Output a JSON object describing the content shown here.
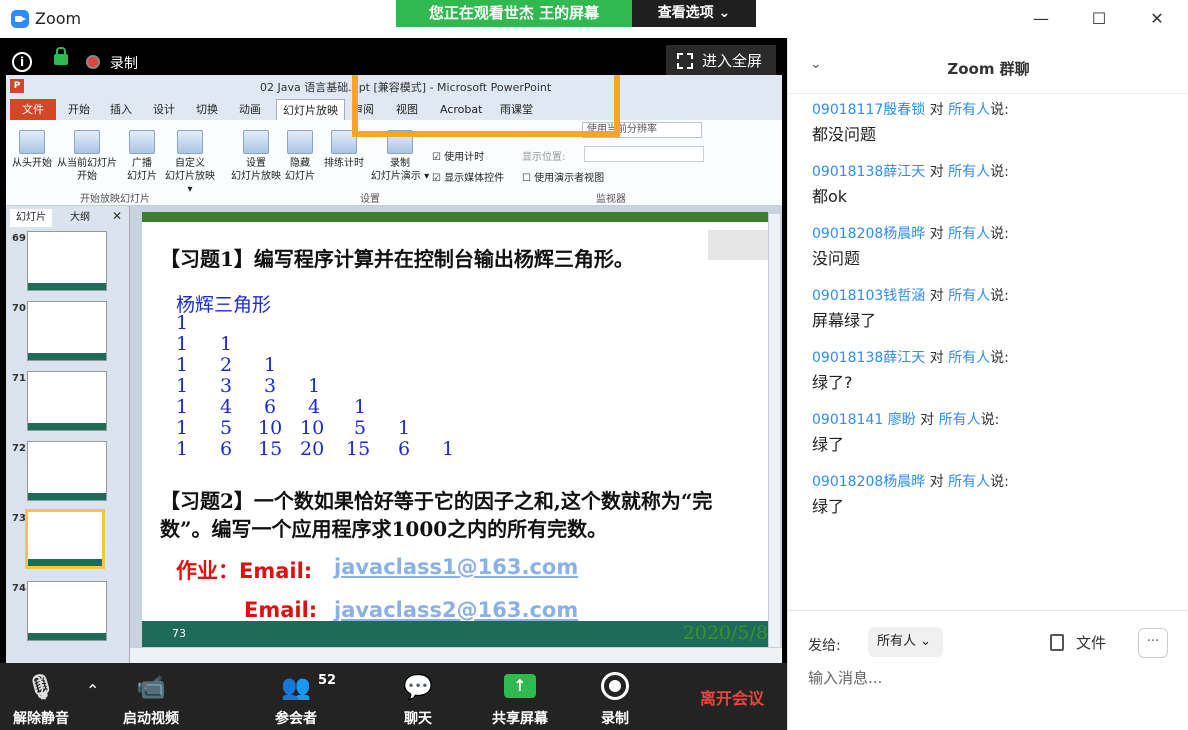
{
  "window": {
    "title": "Zoom",
    "minimize": "—",
    "maximize": "☐",
    "close": "✕"
  },
  "share_banner": {
    "text": "您正在观看世杰 王的屏幕",
    "view_options": "查看选项 ⌄"
  },
  "meeting_top": {
    "info": "i",
    "record_label": "录制",
    "fullscreen": "进入全屏"
  },
  "ppt": {
    "window_title": "02 Java 语言基础.ppt [兼容模式] - Microsoft PowerPoint",
    "tabs": [
      "文件",
      "开始",
      "插入",
      "设计",
      "切换",
      "动画",
      "幻灯片放映",
      "审阅",
      "视图",
      "Acrobat",
      "雨课堂"
    ],
    "ribbon_buttons": [
      {
        "label": "从头开始"
      },
      {
        "label": "从当前幻灯片\n开始"
      },
      {
        "label": "广播\n幻灯片"
      },
      {
        "label": "自定义\n幻灯片放映 ▾"
      },
      {
        "label": "设置\n幻灯片放映"
      },
      {
        "label": "隐藏\n幻灯片"
      },
      {
        "label": "排练计时"
      },
      {
        "label": "录制\n幻灯片演示 ▾"
      }
    ],
    "checkboxes": [
      "使用计时",
      "显示媒体控件",
      "使用演示者视图"
    ],
    "monitor": {
      "resolution": "使用当前分辨率",
      "display_label": "显示位置:"
    },
    "groups": [
      "开始放映幻灯片",
      "设置",
      "监视器"
    ],
    "pane_tabs": [
      "幻灯片",
      "大纲"
    ],
    "thumb_numbers": [
      "69",
      "70",
      "71",
      "72",
      "73",
      "74"
    ],
    "slide": {
      "exercise1": "【习题1】编写程序计算并在控制台输出杨辉三角形。",
      "yh_title": "杨辉三角形",
      "yh_rows": [
        [
          "1"
        ],
        [
          "1",
          "1"
        ],
        [
          "1",
          "2",
          "1"
        ],
        [
          "1",
          "3",
          "3",
          "1"
        ],
        [
          "1",
          "4",
          "6",
          "4",
          "1"
        ],
        [
          "1",
          "5",
          "10",
          "10",
          "5",
          "1"
        ],
        [
          "1",
          "6",
          "15",
          "20",
          "15",
          "6",
          "1"
        ]
      ],
      "exercise2": "【习题2】一个数如果恰好等于它的因子之和,这个数就称为“完数”。编写一个应用程序求1000之内的所有完数。",
      "homework_label": "作业：Email:",
      "email_label": "Email:",
      "email1": "javaclass1@163.com",
      "email2": "javaclass2@163.com",
      "page_number": "73",
      "date": "2020/5/8"
    }
  },
  "toolbar": {
    "unmute": "解除静音",
    "start_video": "启动视频",
    "participants": "参会者",
    "participant_count": "52",
    "chat": "聊天",
    "share": "共享屏幕",
    "record": "录制",
    "leave": "离开会议"
  },
  "chat": {
    "title": "Zoom 群聊",
    "messages": [
      {
        "sender": "09018117殷春锁",
        "to": "所有人",
        "text": "都没问题"
      },
      {
        "sender": "09018138薛江天",
        "to": "所有人",
        "text": "都ok"
      },
      {
        "sender": "09018208杨晨晔",
        "to": "所有人",
        "text": "没问题"
      },
      {
        "sender": "09018103钱哲涵",
        "to": "所有人",
        "text": "屏幕绿了"
      },
      {
        "sender": "09018138薛江天",
        "to": "所有人",
        "text": "绿了?"
      },
      {
        "sender": "09018141 廖盼",
        "to": "所有人",
        "text": "绿了"
      },
      {
        "sender": "09018208杨晨晔",
        "to": "所有人",
        "text": "绿了"
      }
    ],
    "to_word": "对",
    "said_word": "说:",
    "send_to_label": "发给:",
    "send_to_value": "所有人",
    "file_label": "文件",
    "more": "···",
    "input_placeholder": "输入消息..."
  },
  "colors": {
    "accent": "#2d8cff",
    "share_green": "#2fb94f",
    "leave_red": "#e8453c",
    "slide_blue": "#1a2bd6",
    "slide_red": "#e01010"
  }
}
